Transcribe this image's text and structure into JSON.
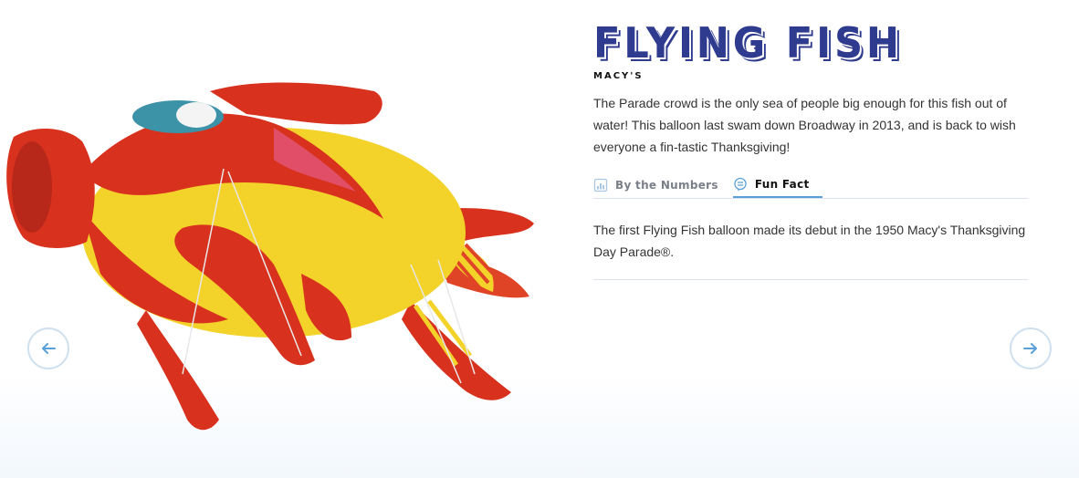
{
  "balloon": {
    "title": "FLYING FISH",
    "sponsor": "MACY'S",
    "description": "The Parade crowd is the only sea of people big enough for this fish out of water! This balloon last swam down Broadway in 2013, and is back to wish everyone a fin-tastic Thanksgiving!"
  },
  "tabs": [
    {
      "label": "By the Numbers",
      "icon": "bar-chart-icon",
      "active": false
    },
    {
      "label": "Fun Fact",
      "icon": "speech-bubble-icon",
      "active": true
    }
  ],
  "fun_fact": {
    "text": "The first Flying Fish balloon made its debut in the 1950 Macy's Thanksgiving Day Parade®."
  },
  "navigation": {
    "prev_icon": "arrow-left-icon",
    "next_icon": "arrow-right-icon"
  },
  "colors": {
    "title": "#2f3b8f",
    "accent": "#5aa0d8",
    "balloon_red": "#d8321e",
    "balloon_yellow": "#f3d22a"
  }
}
